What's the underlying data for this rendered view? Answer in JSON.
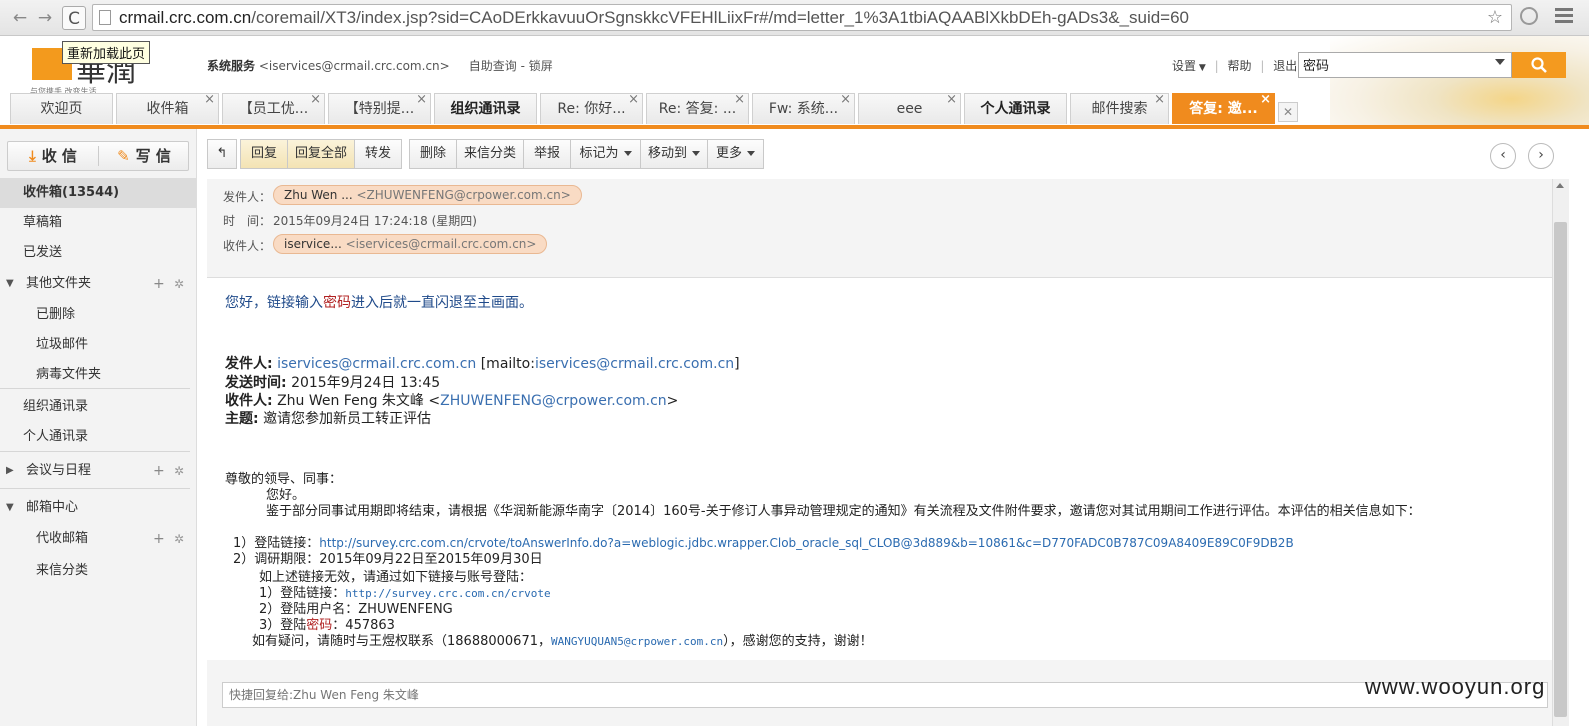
{
  "browser": {
    "url_host": "crmail.crc.com.cn",
    "url_path": "/coremail/XT3/index.jsp?sid=CAoDErkkavuuOrSgnskkcVFEHlLiixFr#/md=letter_1%3A1tbiAQAABlXkbDEh-gADs3&_suid=60",
    "back_icon": "←",
    "forward_icon": "→",
    "reload_icon": "C",
    "star_icon": "☆"
  },
  "header": {
    "logo_text": "華潤",
    "logo_slogan": "与您携手 改变生活",
    "tooltip": "重新加载此页",
    "sys_name": "系统服务",
    "sys_addr": "<iservices@crmail.crc.com.cn>",
    "self_service": "自助查询",
    "lock": "锁屏",
    "settings": "设置",
    "help": "帮助",
    "logout": "退出",
    "search_value": "密码"
  },
  "tabs": [
    {
      "label": "欢迎页",
      "closable": false,
      "bold": false
    },
    {
      "label": "收件箱",
      "closable": true,
      "bold": false
    },
    {
      "label": "【员工优...",
      "closable": true,
      "bold": false
    },
    {
      "label": "【特别提...",
      "closable": true,
      "bold": false
    },
    {
      "label": "组织通讯录",
      "closable": false,
      "bold": true
    },
    {
      "label": "Re: 你好...",
      "closable": true,
      "bold": false
    },
    {
      "label": "Re: 答复: ...",
      "closable": true,
      "bold": false
    },
    {
      "label": "Fw: 系统...",
      "closable": true,
      "bold": false
    },
    {
      "label": "eee",
      "closable": true,
      "bold": false
    },
    {
      "label": "个人通讯录",
      "closable": false,
      "bold": true
    },
    {
      "label": "邮件搜索",
      "closable": true,
      "bold": false
    },
    {
      "label": "答复: 邀...",
      "closable": true,
      "bold": false,
      "active": true
    }
  ],
  "sidebar": {
    "receive": "收 信",
    "compose": "写 信",
    "items": [
      {
        "label": "收件箱(13544)",
        "level": 0,
        "selected": true
      },
      {
        "label": "草稿箱",
        "level": 0
      },
      {
        "label": "已发送",
        "level": 0
      },
      {
        "label": "其他文件夹",
        "level": 0,
        "group": true,
        "expanded": true
      },
      {
        "label": "已删除",
        "level": 1
      },
      {
        "label": "垃圾邮件",
        "level": 1
      },
      {
        "label": "病毒文件夹",
        "level": 1
      },
      {
        "label": "组织通讯录",
        "level": 0
      },
      {
        "label": "个人通讯录",
        "level": 0
      },
      {
        "label": "会议与日程",
        "level": 0,
        "group": true,
        "expanded": false
      },
      {
        "label": "邮箱中心",
        "level": 0,
        "group": true,
        "expanded": true
      },
      {
        "label": "代收邮箱",
        "level": 1
      },
      {
        "label": "来信分类",
        "level": 1
      }
    ]
  },
  "toolbar": {
    "back_icon": "↰",
    "reply": "回复",
    "reply_all": "回复全部",
    "forward": "转发",
    "delete": "删除",
    "classify": "来信分类",
    "report": "举报",
    "mark_as": "标记为",
    "move_to": "移动到",
    "more": "更多",
    "prev_icon": "‹",
    "next_icon": "›"
  },
  "message": {
    "from_label": "发件人：",
    "from_name": "Zhu Wen ...",
    "from_email": "<ZHUWENFENG@crpower.com.cn>",
    "time_label": "时　间：",
    "time_value": "2015年09月24日 17:24:18 (星期四)",
    "to_label": "收件人：",
    "to_name": "iservice...",
    "to_email": "<iservices@crmail.crc.com.cn>"
  },
  "body": {
    "greeting_pre": "您好，链接输入",
    "greeting_red": "密码",
    "greeting_post": "进入后就一直闪退至主画面。",
    "q_from_label": "发件人:",
    "q_from_email": "iservices@crmail.crc.com.cn",
    "q_from_mailto_pre": "[mailto:",
    "q_from_mailto": "iservices@crmail.crc.com.cn",
    "q_from_mailto_post": "]",
    "q_time_label": "发送时间:",
    "q_time": "2015年9月24日 13:45",
    "q_to_label": "收件人:",
    "q_to_name": "Zhu Wen Feng 朱文峰 <",
    "q_to_email": "ZHUWENFENG@crpower.com.cn",
    "q_to_close": ">",
    "q_subject_label": "主题:",
    "q_subject": "邀请您参加新员工转正评估",
    "dear": "尊敬的领导、同事：",
    "hello": "您好。",
    "para": "鉴于部分同事试用期即将结束，请根据《华润新能源华南字〔2014〕160号-关于修订人事异动管理规定的通知》有关流程及文件附件要求，邀请您对其试用期间工作进行评估。本评估的相关信息如下：",
    "item1_label": "1）登陆链接：",
    "item1_link": "http://survey.crc.com.cn/crvote/toAnswerInfo.do?a=weblogic.jdbc.wrapper.Clob_oracle_sql_CLOB@3d889&b=10861&c=D770FADC0B787C09A8409E89C0F9DB2B",
    "item2": "2）调研期限：2015年09月22日至2015年09月30日",
    "fallback": "如上述链接无效，请通过如下链接与账号登陆：",
    "sub1_label": "1）登陆链接：",
    "sub1_link": "http://survey.crc.com.cn/crvote",
    "sub2": "2）登陆用户名：ZHUWENFENG",
    "sub3_pre": "3）登陆",
    "sub3_red": "密码",
    "sub3_post": "：457863",
    "contact_pre": "如有疑问，请随时与王煜权联系（18688000671，",
    "contact_email": "WANGYUQUAN5@crpower.com.cn",
    "contact_post": "），感谢您的支持，谢谢！"
  },
  "quick_reply": {
    "placeholder": "快捷回复给:Zhu Wen Feng 朱文峰"
  },
  "watermark": "www.wooyun.org",
  "colors": {
    "accent": "#f08b1e",
    "pill": "#f9dbc4",
    "link": "#3a6fb0"
  }
}
